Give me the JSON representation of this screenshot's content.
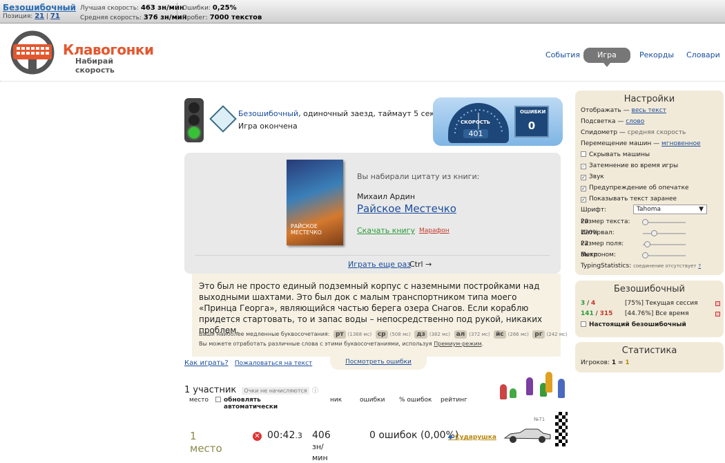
{
  "topbar": {
    "username": "Безошибочный",
    "dash": "—",
    "position_label": "Позиция:",
    "position_a": "21",
    "position_b": "71",
    "best_speed_label": "Лучшая скорость:",
    "best_speed": "463 зн/мин",
    "avg_speed_label": "Средняя скорость:",
    "avg_speed": "376 зн/мин",
    "errors_label": "Ошибки:",
    "errors": "0,25%",
    "mileage_label": "Пробег:",
    "mileage": "7000 текстов"
  },
  "logo": {
    "title": "Клавогонки",
    "tagline": "Набирай скорость"
  },
  "nav": {
    "events": "События",
    "game": "Игра",
    "records": "Рекорды",
    "dicts": "Словари"
  },
  "game": {
    "mode_user": "Безошибочный",
    "mode_rest": ", одиночный заезд, таймаут 5 сек",
    "state": "Игра окончена",
    "speed_label": "СКОРОСТЬ",
    "speed_value": "401",
    "errors_label": "ОШИБКИ",
    "errors_value": "0"
  },
  "quote": {
    "intro": "Вы набирали цитату из книги:",
    "author": "Михаил Ардин",
    "book_title": "Райское Местечко",
    "cover_text": "РАЙСКОЕ МЕСТЕЧКО",
    "download": "Скачать книгу",
    "marathon": "Марафон",
    "play_again": "Играть еще раз",
    "ctrl": "Ctrl →"
  },
  "text": "Это был не просто единый подземный корпус с наземными постройками над выходными шахтами. Это был док с малым транспортником типа моего «Принца Георга», являющийся частью берега озера Снагов. Если кораблю придется стартовать, то и запас воды – непосредственно под рукой, никаких проблем.",
  "slow": {
    "label": "Ваши наиболее медленные буквосочетания:",
    "pairs": [
      {
        "k": "рт",
        "ms": "(1368 мс)"
      },
      {
        "k": "ср",
        "ms": "(508 мс)"
      },
      {
        "k": "дз",
        "ms": "(382 мс)"
      },
      {
        "k": "ал",
        "ms": "(372 мс)"
      },
      {
        "k": "йс",
        "ms": "(266 мс)"
      },
      {
        "k": "рг",
        "ms": "(242 мс)"
      }
    ],
    "premium_text": "Вы можете отработать различные слова с этими буквосочетаниями, используя",
    "premium_link": "Премиум-режим",
    "premium_end": "."
  },
  "links": {
    "howto": "Как играть?",
    "complain": "Пожаловаться на текст",
    "view_errors": "Посмотреть ошибки"
  },
  "players": {
    "count": "1 участник",
    "note": "Очки не начисляются",
    "headers": {
      "place": "место",
      "auto": "обновлять автоматически",
      "nick": "ник",
      "errors": "ошибки",
      "pct": "% ошибок",
      "rating": "рейтинг"
    }
  },
  "result": {
    "place": "1 место",
    "time": "00:42",
    "time_frac": ".3",
    "speed": "406",
    "speed_unit": "зн/мин",
    "errors": "0 ошибок (0,00%)",
    "nick": "Сударушка",
    "num": "№71"
  },
  "settings": {
    "title": "Настройки",
    "display_label": "Отображать —",
    "display_value": "весь текст",
    "highlight_label": "Подсветка —",
    "highlight_value": "слово",
    "speedo_label": "Спидометр —",
    "speedo_value": "средняя скорость",
    "move_label": "Перемещение машин —",
    "move_value": "мгновенное",
    "hide_cars": "Скрывать машины",
    "dim": "Затемнение во время игры",
    "sound": "Звук",
    "warn": "Предупреждение об опечатке",
    "show_text": "Показывать текст заранее",
    "font_label": "Шрифт:",
    "font_value": "Tahoma",
    "size_label": "Размер текста:",
    "size_value": "20",
    "interval_label": "Интервал:",
    "interval_value": "120%",
    "field_label": "Размер поля:",
    "field_value": "22",
    "metro_label": "Метроном:",
    "metro_value": "Выкл",
    "ts_label": "TypingStatistics:",
    "ts_value": "соединение отсутствует",
    "ts_q": "?"
  },
  "bpanel": {
    "title": "Безошибочный",
    "r1_a": "3",
    "r1_b": "4",
    "r1_text": "[75%] Текущая сессия",
    "r2_a": "141",
    "r2_b": "315",
    "r2_text": "[44.76%] Все время",
    "real": "Настоящий безошибочный"
  },
  "stats": {
    "title": "Статистика",
    "players_label": "Игроков:",
    "players_a": "1",
    "players_b": "1"
  }
}
